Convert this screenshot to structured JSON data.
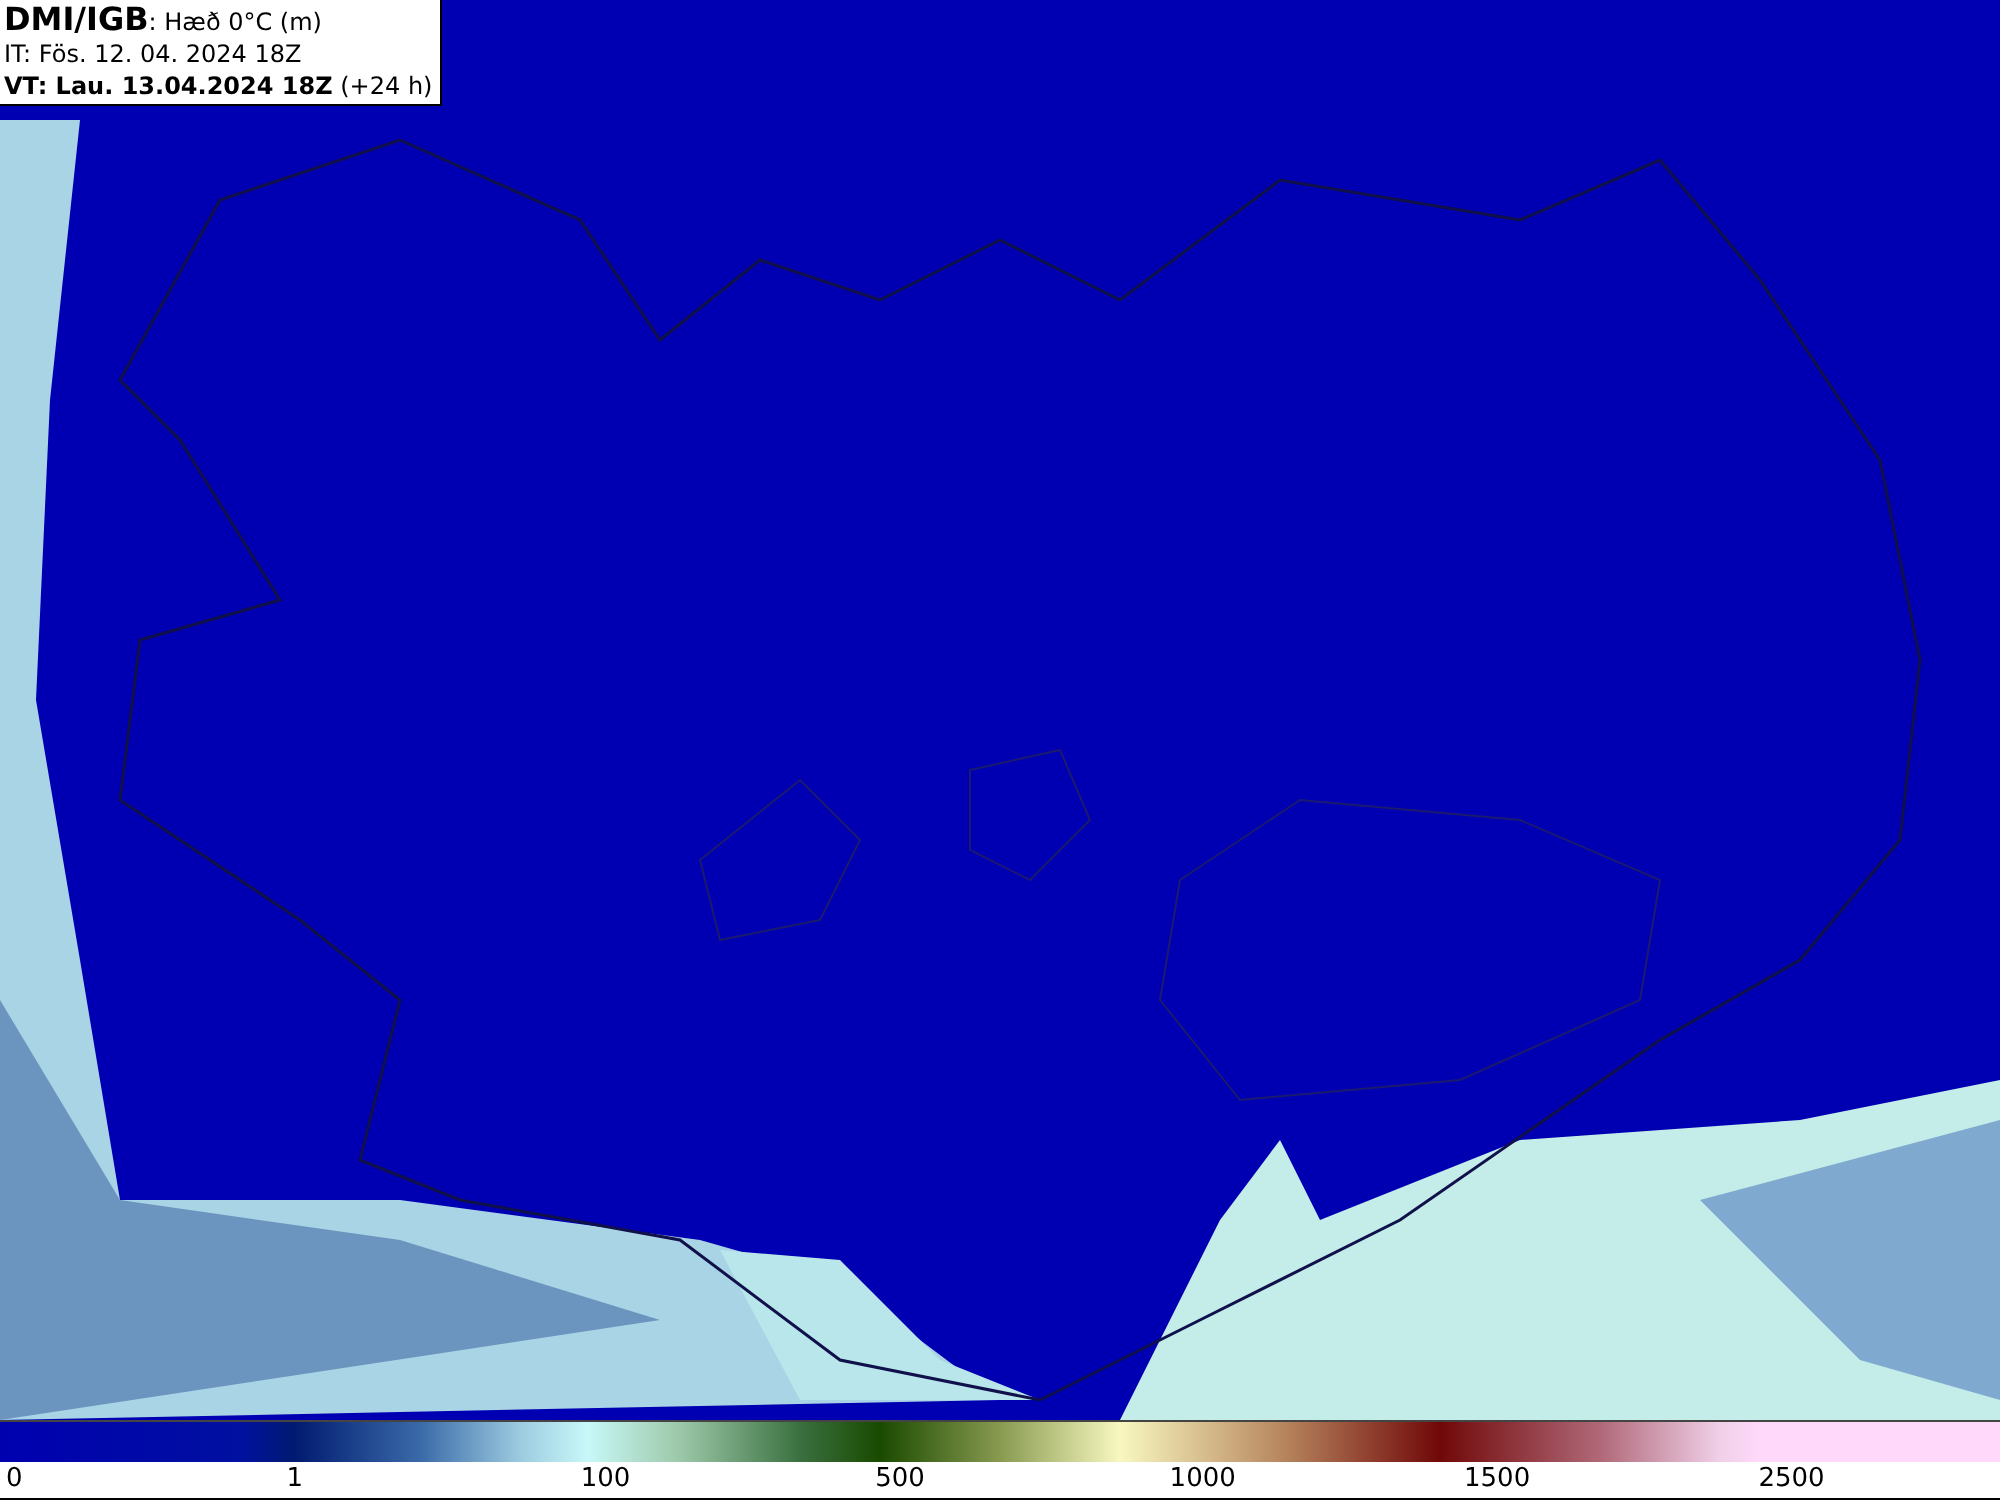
{
  "header": {
    "lines": [
      "**DMI/IGB**: Hæð 0°C (m)",
      "IT: Fös. 12. 04. 2024 18Z",
      "**VT: Lau. 13.04.2024 18Z** (+24 h)"
    ]
  },
  "legend": {
    "labels": [
      "0",
      "1",
      "100",
      "500",
      "1000",
      "1500",
      "2500"
    ]
  }
}
